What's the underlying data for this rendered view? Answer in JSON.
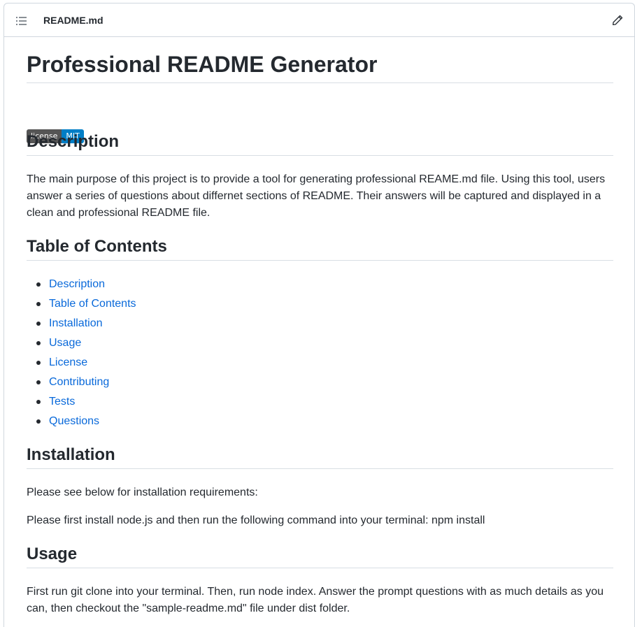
{
  "file": {
    "name": "README.md",
    "toc_icon": "list-unordered-icon",
    "edit_icon": "pencil-icon"
  },
  "readme": {
    "title": "Professional README Generator",
    "badge": {
      "label": "license",
      "value": "MIT",
      "label_color": "#555555",
      "value_color": "#007ec6"
    },
    "description": {
      "heading": "Description",
      "text": "The main purpose of this project is to provide a tool for generating professional REAME.md file. Using this tool, users answer a series of questions about differnet sections of README. Their answers will be captured and displayed in a clean and professional README file."
    },
    "toc": {
      "heading": "Table of Contents",
      "items": [
        "Description",
        "Table of Contents",
        "Installation",
        "Usage",
        "License",
        "Contributing",
        "Tests",
        "Questions"
      ]
    },
    "installation": {
      "heading": "Installation",
      "text1": "Please see below for installation requirements:",
      "text2": "Please first install node.js and then run the following command into your terminal: npm install"
    },
    "usage": {
      "heading": "Usage",
      "text": "First run git clone into your terminal. Then, run node index. Answer the prompt questions with as much details as you can, then checkout the \"sample-readme.md\" file under dist folder."
    }
  },
  "colors": {
    "link": "#0969da",
    "text": "#24292f",
    "border": "#d0d7de"
  }
}
